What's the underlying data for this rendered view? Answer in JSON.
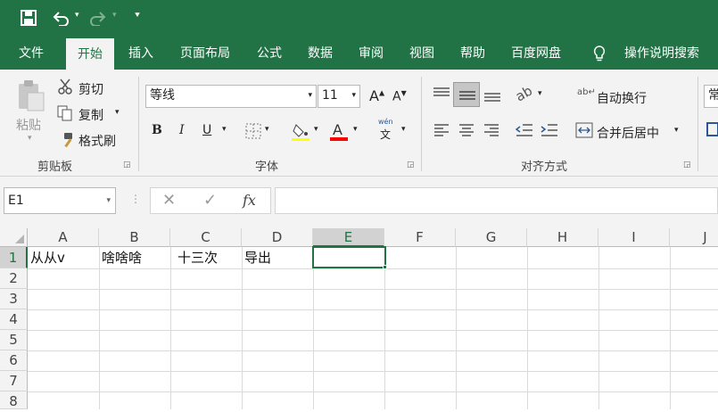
{
  "qat": {
    "save_icon": "save-icon",
    "undo_icon": "undo-icon",
    "redo_icon": "redo-icon",
    "customize_icon": "customize-qat-icon"
  },
  "tabs": [
    {
      "label": "文件",
      "active": false
    },
    {
      "label": "开始",
      "active": true
    },
    {
      "label": "插入",
      "active": false
    },
    {
      "label": "页面布局",
      "active": false
    },
    {
      "label": "公式",
      "active": false
    },
    {
      "label": "数据",
      "active": false
    },
    {
      "label": "审阅",
      "active": false
    },
    {
      "label": "视图",
      "active": false
    },
    {
      "label": "帮助",
      "active": false
    },
    {
      "label": "百度网盘",
      "active": false
    }
  ],
  "tell_me": "操作说明搜索",
  "ribbon": {
    "clipboard": {
      "paste": "粘贴",
      "cut": "剪切",
      "copy": "复制",
      "format_painter": "格式刷",
      "label": "剪贴板"
    },
    "font": {
      "name": "等线",
      "size": "11",
      "label": "字体",
      "bold": "B",
      "italic": "I",
      "underline": "U",
      "wen": "wén",
      "wen_char": "文"
    },
    "alignment": {
      "wrap": "自动换行",
      "merge": "合并后居中",
      "label": "对齐方式"
    },
    "number": {
      "format": "常"
    }
  },
  "formula_bar": {
    "name_box": "E1",
    "fx": "fx",
    "formula": ""
  },
  "sheet": {
    "columns": [
      "A",
      "B",
      "C",
      "D",
      "E",
      "F",
      "G",
      "H",
      "I",
      "J"
    ],
    "selected_column": "E",
    "rows": [
      "1",
      "2",
      "3",
      "4",
      "5",
      "6",
      "7",
      "8"
    ],
    "cells": {
      "A1": "从从v",
      "B1": "啥啥啥",
      "C1": "十三次",
      "D1": "导出"
    },
    "active_cell": "E1"
  },
  "colors": {
    "accent": "#217346",
    "font_highlight": "#FFFF00",
    "font_color": "#FF0000"
  }
}
